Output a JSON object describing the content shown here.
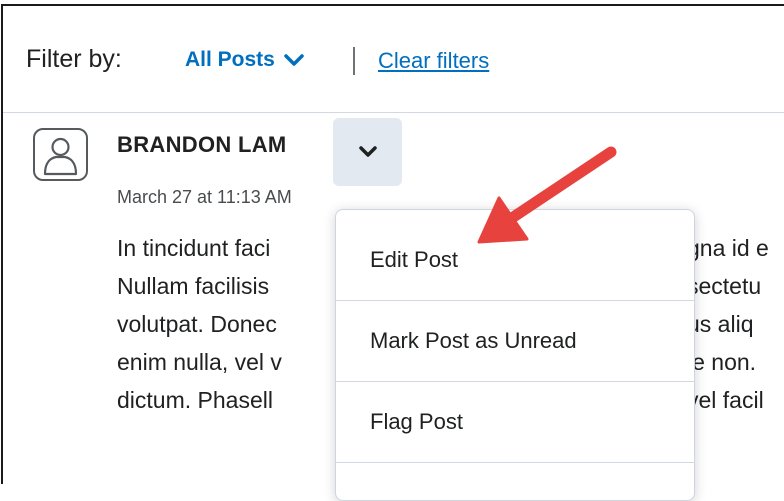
{
  "filter": {
    "label": "Filter by:",
    "dropdown_value": "All Posts",
    "clear_label": "Clear filters"
  },
  "post": {
    "author": "BRANDON LAM",
    "timestamp": "March 27 at 11:13 AM",
    "body_left": [
      "In tincidunt faci",
      "Nullam facilisis",
      "volutpat. Donec",
      "enim nulla, vel v",
      "dictum. Phasell"
    ],
    "body_right": [
      "gna id e",
      "sectetu",
      "us aliq",
      "ie non.",
      "vel facil"
    ]
  },
  "menu": {
    "items": [
      "Edit Post",
      "Mark Post as Unread",
      "Flag Post"
    ]
  },
  "icons": {
    "avatar": "user-avatar-icon",
    "chevron": "chevron-down-icon",
    "annotation": "red-arrow-icon"
  },
  "colors": {
    "link": "#006fbf",
    "button_bg": "#e3e9f1",
    "arrow": "#e8423f"
  }
}
